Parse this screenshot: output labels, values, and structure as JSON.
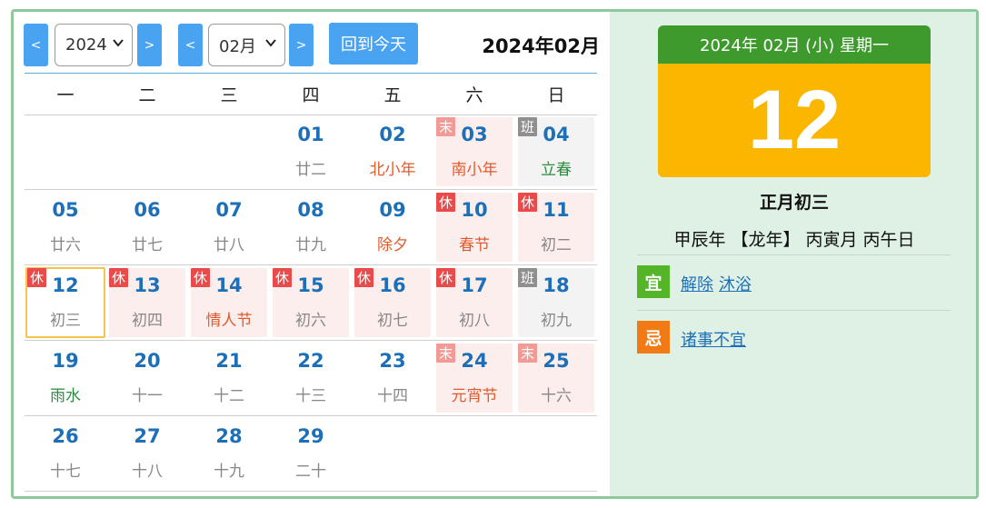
{
  "toolbar": {
    "prev_year_label": "<",
    "next_year_label": ">",
    "year_value": "2024",
    "prev_month_label": "<",
    "next_month_label": ">",
    "month_value": "02月",
    "today_label": "回到今天",
    "month_title": "2024年02月"
  },
  "weekdays": [
    "一",
    "二",
    "三",
    "四",
    "五",
    "六",
    "日"
  ],
  "weeks": [
    [
      {
        "day": "",
        "lunar": ""
      },
      {
        "day": "",
        "lunar": ""
      },
      {
        "day": "",
        "lunar": ""
      },
      {
        "day": "01",
        "lunar": "廿二",
        "type": "normal"
      },
      {
        "day": "02",
        "lunar": "北小年",
        "type": "normal",
        "lunar_color": "red"
      },
      {
        "day": "03",
        "lunar": "南小年",
        "type": "holiday",
        "badge": "末",
        "badge_type": "mo",
        "lunar_color": "red"
      },
      {
        "day": "04",
        "lunar": "立春",
        "type": "work",
        "badge": "班",
        "badge_type": "ban",
        "lunar_color": "green"
      }
    ],
    [
      {
        "day": "05",
        "lunar": "廿六",
        "type": "normal"
      },
      {
        "day": "06",
        "lunar": "廿七",
        "type": "normal"
      },
      {
        "day": "07",
        "lunar": "廿八",
        "type": "normal"
      },
      {
        "day": "08",
        "lunar": "廿九",
        "type": "normal"
      },
      {
        "day": "09",
        "lunar": "除夕",
        "type": "normal",
        "lunar_color": "red"
      },
      {
        "day": "10",
        "lunar": "春节",
        "type": "holiday",
        "badge": "休",
        "badge_type": "xiu",
        "lunar_color": "red"
      },
      {
        "day": "11",
        "lunar": "初二",
        "type": "holiday",
        "badge": "休",
        "badge_type": "xiu"
      }
    ],
    [
      {
        "day": "12",
        "lunar": "初三",
        "type": "selected",
        "badge": "休",
        "badge_type": "xiu"
      },
      {
        "day": "13",
        "lunar": "初四",
        "type": "holiday",
        "badge": "休",
        "badge_type": "xiu"
      },
      {
        "day": "14",
        "lunar": "情人节",
        "type": "holiday",
        "badge": "休",
        "badge_type": "xiu",
        "lunar_color": "red"
      },
      {
        "day": "15",
        "lunar": "初六",
        "type": "holiday",
        "badge": "休",
        "badge_type": "xiu"
      },
      {
        "day": "16",
        "lunar": "初七",
        "type": "holiday",
        "badge": "休",
        "badge_type": "xiu"
      },
      {
        "day": "17",
        "lunar": "初八",
        "type": "holiday",
        "badge": "休",
        "badge_type": "xiu"
      },
      {
        "day": "18",
        "lunar": "初九",
        "type": "work",
        "badge": "班",
        "badge_type": "ban"
      }
    ],
    [
      {
        "day": "19",
        "lunar": "雨水",
        "type": "normal",
        "lunar_color": "green"
      },
      {
        "day": "20",
        "lunar": "十一",
        "type": "normal"
      },
      {
        "day": "21",
        "lunar": "十二",
        "type": "normal"
      },
      {
        "day": "22",
        "lunar": "十三",
        "type": "normal"
      },
      {
        "day": "23",
        "lunar": "十四",
        "type": "normal"
      },
      {
        "day": "24",
        "lunar": "元宵节",
        "type": "holiday",
        "badge": "末",
        "badge_type": "mo",
        "lunar_color": "red"
      },
      {
        "day": "25",
        "lunar": "十六",
        "type": "holiday",
        "badge": "末",
        "badge_type": "mo"
      }
    ],
    [
      {
        "day": "26",
        "lunar": "十七",
        "type": "normal"
      },
      {
        "day": "27",
        "lunar": "十八",
        "type": "normal"
      },
      {
        "day": "28",
        "lunar": "十九",
        "type": "normal"
      },
      {
        "day": "29",
        "lunar": "二十",
        "type": "normal"
      },
      {
        "day": "",
        "lunar": ""
      },
      {
        "day": "",
        "lunar": ""
      },
      {
        "day": "",
        "lunar": ""
      }
    ]
  ],
  "detail": {
    "header": "2024年 02月 (小) 星期一",
    "big_day": "12",
    "lunar_date": "正月初三",
    "ganzhi": "甲辰年 【龙年】 丙寅月 丙午日",
    "yi_label": "宜",
    "yi_items": [
      "解除",
      "沐浴"
    ],
    "ji_label": "忌",
    "ji_items": [
      "诸事不宜"
    ]
  },
  "colors": {
    "accent_blue": "#4aa3f0",
    "day_number": "#1d6fb8",
    "holiday_bg": "#fdeeee",
    "work_bg": "#f3f3f3",
    "selected_border": "#f5c54a",
    "card_header": "#3f9a2e",
    "card_body": "#fbb700",
    "panel_bg": "#dff1e4",
    "yi_tag": "#55b528",
    "ji_tag": "#f27a14"
  }
}
